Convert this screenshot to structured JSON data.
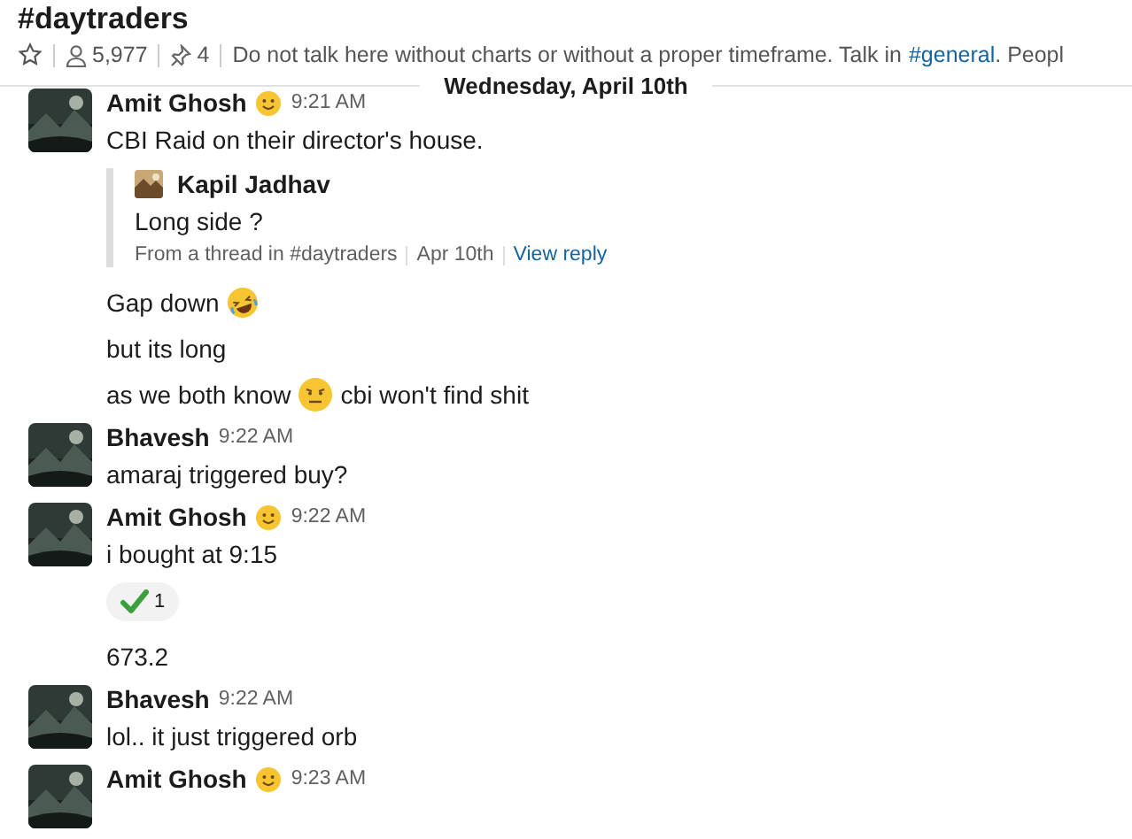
{
  "channel": {
    "title": "#daytraders",
    "starred": false,
    "members": "5,977",
    "pins": "4",
    "topic_before": "Do not talk here without charts or without a proper timeframe. Talk in",
    "topic_link": "#general",
    "topic_after": ". Peopl"
  },
  "date_divider": "Wednesday, April 10th",
  "messages": [
    {
      "author": "Amit Ghosh",
      "status_emoji": true,
      "time": "9:21 AM",
      "body": [
        {
          "kind": "text",
          "parts": [
            {
              "kind": "text",
              "text": "CBI Raid on their director's house."
            }
          ]
        },
        {
          "kind": "quote",
          "author": "Kapil Jadhav",
          "text": "Long side ?",
          "footer": [
            "From a thread in #daytraders",
            "Apr 10th"
          ],
          "link": "View reply"
        },
        {
          "kind": "text",
          "parts": [
            {
              "kind": "text",
              "text": "Gap down"
            },
            {
              "kind": "laughing"
            }
          ]
        },
        {
          "kind": "text",
          "parts": [
            {
              "kind": "text",
              "text": "but its long"
            }
          ]
        },
        {
          "kind": "text",
          "parts": [
            {
              "kind": "text",
              "text": "as we both know"
            },
            {
              "kind": "grimace"
            },
            {
              "kind": "text",
              "text": "cbi won't find shit"
            }
          ]
        }
      ]
    },
    {
      "author": "Bhavesh",
      "status_emoji": false,
      "time": "9:22 AM",
      "body": [
        {
          "kind": "text",
          "parts": [
            {
              "kind": "text",
              "text": "amaraj triggered buy?"
            }
          ]
        }
      ]
    },
    {
      "author": "Amit Ghosh",
      "status_emoji": true,
      "time": "9:22 AM",
      "body": [
        {
          "kind": "text",
          "parts": [
            {
              "kind": "text",
              "text": "i bought at 9:15"
            }
          ]
        },
        {
          "kind": "reaction",
          "count": "1"
        },
        {
          "kind": "text",
          "parts": [
            {
              "kind": "text",
              "text": "673.2"
            }
          ]
        }
      ]
    },
    {
      "author": "Bhavesh",
      "status_emoji": false,
      "time": "9:22 AM",
      "body": [
        {
          "kind": "text",
          "parts": [
            {
              "kind": "text",
              "text": "lol.. it just triggered orb"
            }
          ]
        }
      ]
    },
    {
      "author": "Amit Ghosh",
      "status_emoji": true,
      "time": "9:23 AM"
    }
  ]
}
